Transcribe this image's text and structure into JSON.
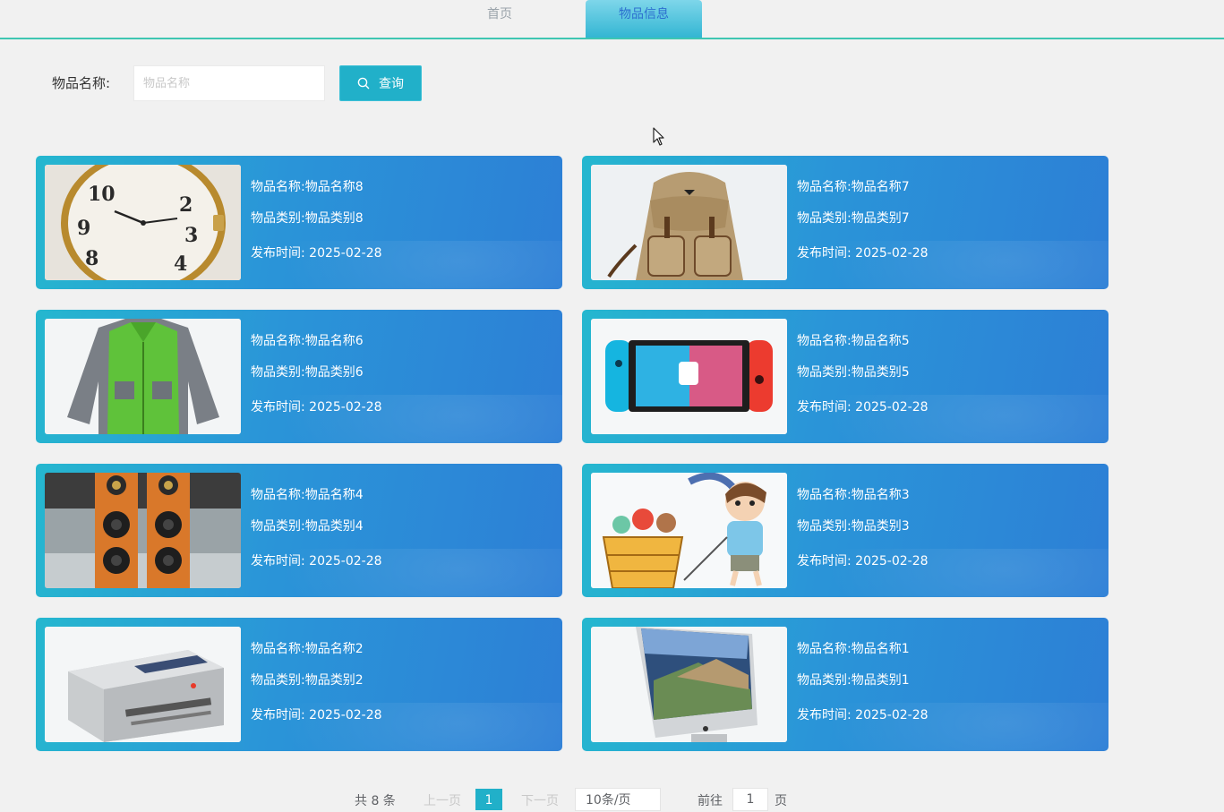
{
  "nav": {
    "items": [
      {
        "label": "首页"
      },
      {
        "label": "物品信息"
      }
    ]
  },
  "search": {
    "label": "物品名称:",
    "placeholder": "物品名称",
    "value": "",
    "button_label": "查询",
    "button_icon": "search-icon"
  },
  "cards": [
    {
      "name": "物品名称:物品名称8",
      "category": "物品类别:物品类别8",
      "time": "发布时间:  2025-02-28",
      "image": "wristwatch"
    },
    {
      "name": "物品名称:物品名称7",
      "category": "物品类别:物品类别7",
      "time": "发布时间:  2025-02-28",
      "image": "backpack"
    },
    {
      "name": "物品名称:物品名称6",
      "category": "物品类别:物品类别6",
      "time": "发布时间:  2025-02-28",
      "image": "green-jacket"
    },
    {
      "name": "物品名称:物品名称5",
      "category": "物品类别:物品类别5",
      "time": "发布时间:  2025-02-28",
      "image": "game-console"
    },
    {
      "name": "物品名称:物品名称4",
      "category": "物品类别:物品类别4",
      "time": "发布时间:  2025-02-28",
      "image": "speakers"
    },
    {
      "name": "物品名称:物品名称3",
      "category": "物品类别:物品类别3",
      "time": "发布时间:  2025-02-28",
      "image": "cartoon-child-with-toys"
    },
    {
      "name": "物品名称:物品名称2",
      "category": "物品类别:物品类别2",
      "time": "发布时间:  2025-02-28",
      "image": "printer"
    },
    {
      "name": "物品名称:物品名称1",
      "category": "物品类别:物品类别1",
      "time": "发布时间:  2025-02-28",
      "image": "desktop-computer"
    }
  ],
  "pagination": {
    "total": "共 8 条",
    "prev": "上一页",
    "current_page": "1",
    "next": "下一页",
    "page_size": "10条/页",
    "goto_prefix": "前往",
    "goto_value": "1",
    "goto_suffix": "页"
  },
  "colors": {
    "accent": "#21b0c9",
    "card_gradient_start": "#25b7cf",
    "card_gradient_end": "#2d7fd6",
    "nav_underline": "#3ec6b2",
    "background": "#f1f1f1"
  }
}
